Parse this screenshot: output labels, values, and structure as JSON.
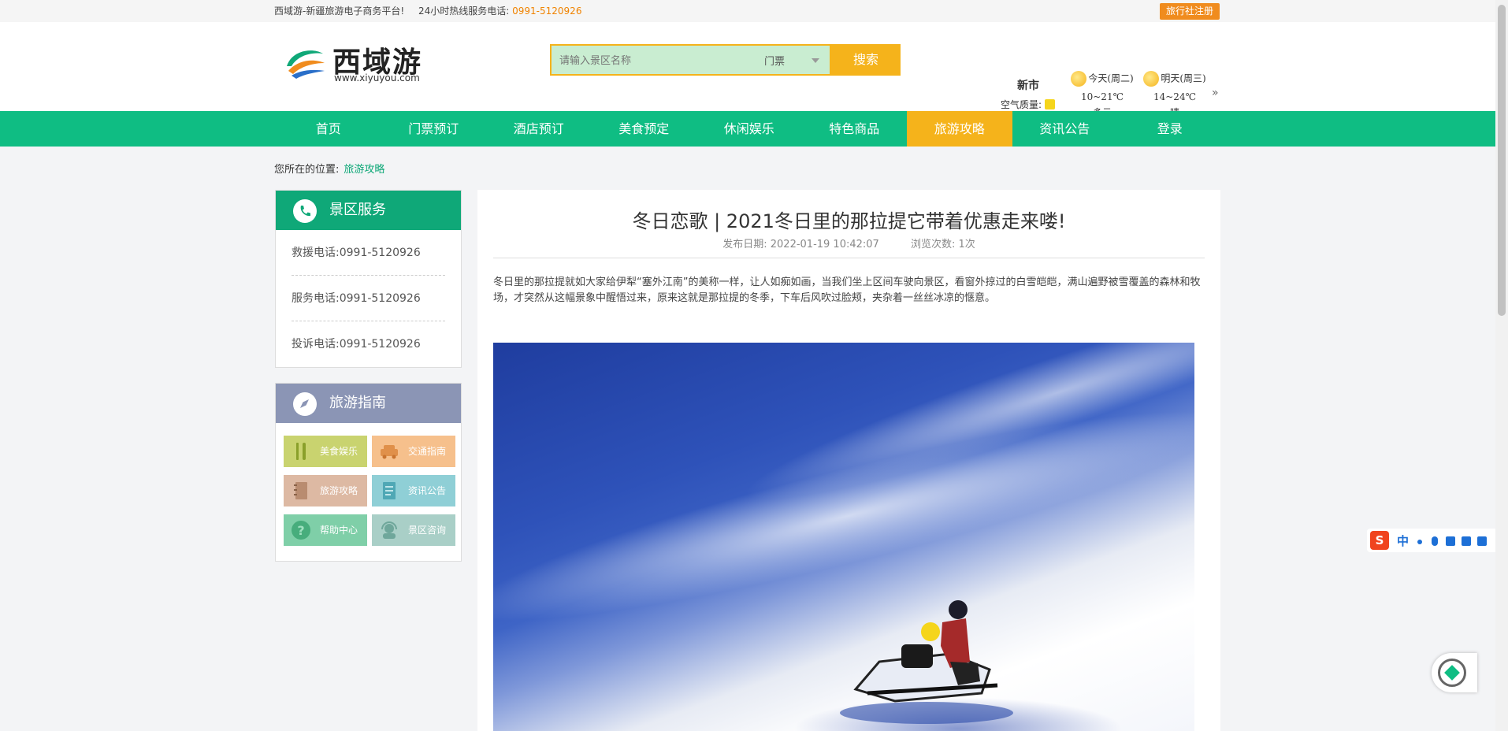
{
  "topbar": {
    "site": "西域游-新疆旅游电子商务平台!",
    "hotline_label": "24小时热线服务电话:",
    "hotline": "0991-5120926",
    "agency_register": "旅行社注册"
  },
  "logo": {
    "name": "西域游",
    "url": "www.xiyuyou.com"
  },
  "search": {
    "placeholder": "请输入景区名称",
    "category": "门票",
    "button": "搜索"
  },
  "weather": {
    "city": "新市",
    "air_quality_label": "空气质量:",
    "today": {
      "label": "今天(周二)",
      "temp": "10~21℃",
      "desc": "多云"
    },
    "tomorrow": {
      "label": "明天(周三)",
      "temp": "14~24℃",
      "desc": "晴"
    },
    "more": "»"
  },
  "nav": {
    "items": [
      {
        "label": "首页"
      },
      {
        "label": "门票预订"
      },
      {
        "label": "酒店预订"
      },
      {
        "label": "美食预定"
      },
      {
        "label": "休闲娱乐"
      },
      {
        "label": "特色商品"
      },
      {
        "label": "旅游攻略"
      },
      {
        "label": "资讯公告"
      },
      {
        "label": "登录"
      }
    ],
    "active": "旅游攻略",
    "active_color": "#f5b31b",
    "bar_color": "#0fbd83"
  },
  "breadcrumb": {
    "prefix": "您所在的位置:",
    "current": "旅游攻略"
  },
  "service": {
    "title": "景区服务",
    "rows": [
      {
        "text": "救援电话:0991-5120926"
      },
      {
        "text": "服务电话:0991-5120926"
      },
      {
        "text": "投诉电话:0991-5120926"
      }
    ]
  },
  "guide": {
    "title": "旅游指南",
    "tiles": [
      {
        "label": "美食娱乐",
        "icon": "fork-knife-icon",
        "color": "#c9d36f"
      },
      {
        "label": "交通指南",
        "icon": "car-icon",
        "color": "#f6c08c"
      },
      {
        "label": "旅游攻略",
        "icon": "notebook-icon",
        "color": "#ddb9a3"
      },
      {
        "label": "资讯公告",
        "icon": "document-icon",
        "color": "#8fcfd6"
      },
      {
        "label": "帮助中心",
        "icon": "question-icon",
        "color": "#7fcfa8"
      },
      {
        "label": "景区咨询",
        "icon": "headset-icon",
        "color": "#a9cfc7"
      }
    ]
  },
  "article": {
    "title": "冬日恋歌 | 2021冬日里的那拉提它带着优惠走来喽!",
    "published_label": "发布日期:",
    "published": "2022-01-19 10:42:07",
    "views_label": "浏览次数:",
    "views": "1次",
    "body": "冬日里的那拉提就如大家给伊犁“塞外江南”的美称一样，让人如痴如画，当我们坐上区间车驶向景区，看窗外掠过的白雪皑皑，满山遍野被雪覆盖的森林和牧场，才突然从这幅景象中醒悟过来，原来这就是那拉提的冬季，下车后风吹过脸颊，夹杂着一丝丝冰凉的惬意。"
  },
  "ime": {
    "logo": "S",
    "mode": "中"
  }
}
